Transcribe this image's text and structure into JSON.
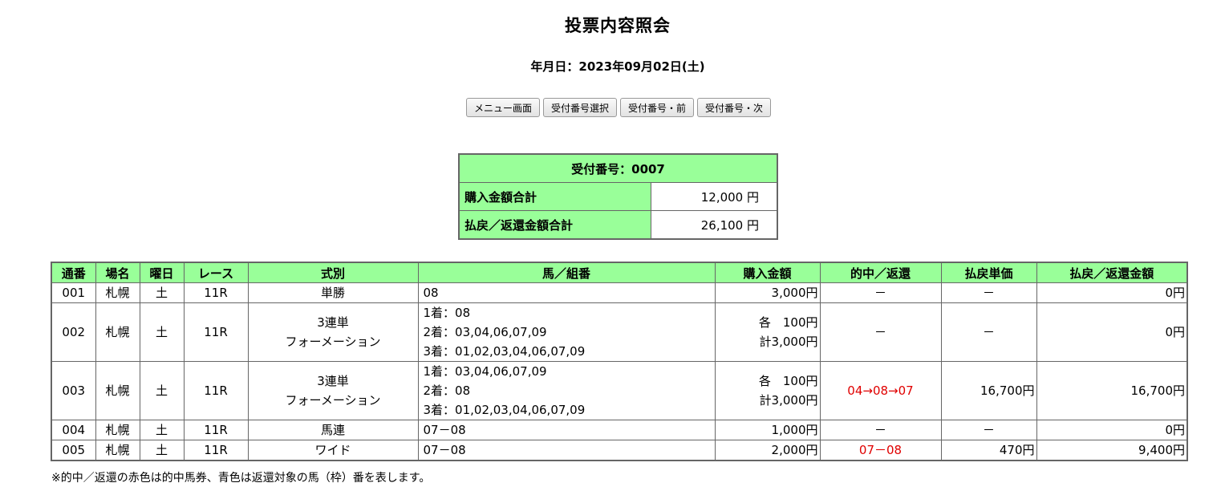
{
  "page": {
    "title": "投票内容照会",
    "date": "年月日：2023年09月02日(土)"
  },
  "buttons": {
    "menu": "メニュー画面",
    "select": "受付番号選択",
    "prev": "受付番号・前",
    "next": "受付番号・次"
  },
  "summary": {
    "receipt": "受付番号：0007",
    "purchase_label": "購入金額合計",
    "purchase_value": "12,000 円",
    "refund_label": "払戻／返還金額合計",
    "refund_value": "26,100 円"
  },
  "table": {
    "headers": [
      "通番",
      "場名",
      "曜日",
      "レース",
      "式別",
      "馬／組番",
      "購入金額",
      "的中／返還",
      "払戻単価",
      "払戻／返還金額"
    ],
    "rows": [
      {
        "no": "001",
        "venue": "札幌",
        "day": "土",
        "race": "11R",
        "type": [
          "単勝"
        ],
        "horses": [
          "08"
        ],
        "amount": [
          "3,000円"
        ],
        "hit": "－",
        "unit": "－",
        "payout": "0円"
      },
      {
        "no": "002",
        "venue": "札幌",
        "day": "土",
        "race": "11R",
        "type": [
          "3連単",
          "フォーメーション"
        ],
        "horses": [
          "1着：08",
          "2着：03,04,06,07,09",
          "3着：01,02,03,04,06,07,09"
        ],
        "amount": [
          "各　100円",
          "計3,000円"
        ],
        "hit": "－",
        "unit": "－",
        "payout": "0円"
      },
      {
        "no": "003",
        "venue": "札幌",
        "day": "土",
        "race": "11R",
        "type": [
          "3連単",
          "フォーメーション"
        ],
        "horses": [
          "1着：03,04,06,07,09",
          "2着：08",
          "3着：01,02,03,04,06,07,09"
        ],
        "amount": [
          "各　100円",
          "計3,000円"
        ],
        "hit": "04→08→07",
        "unit": "16,700円",
        "payout": "16,700円"
      },
      {
        "no": "004",
        "venue": "札幌",
        "day": "土",
        "race": "11R",
        "type": [
          "馬連"
        ],
        "horses": [
          "07－08"
        ],
        "amount": [
          "1,000円"
        ],
        "hit": "－",
        "unit": "－",
        "payout": "0円"
      },
      {
        "no": "005",
        "venue": "札幌",
        "day": "土",
        "race": "11R",
        "type": [
          "ワイド"
        ],
        "horses": [
          "07－08"
        ],
        "amount": [
          "2,000円"
        ],
        "hit": "07－08",
        "unit": "470円",
        "payout": "9,400円"
      }
    ]
  },
  "note": "※的中／返還の赤色は的中馬券、青色は返還対象の馬（枠）番を表します。",
  "colors": {
    "header_bg": "#99ff99",
    "hit_text": "#e00000",
    "border": "#666666"
  }
}
